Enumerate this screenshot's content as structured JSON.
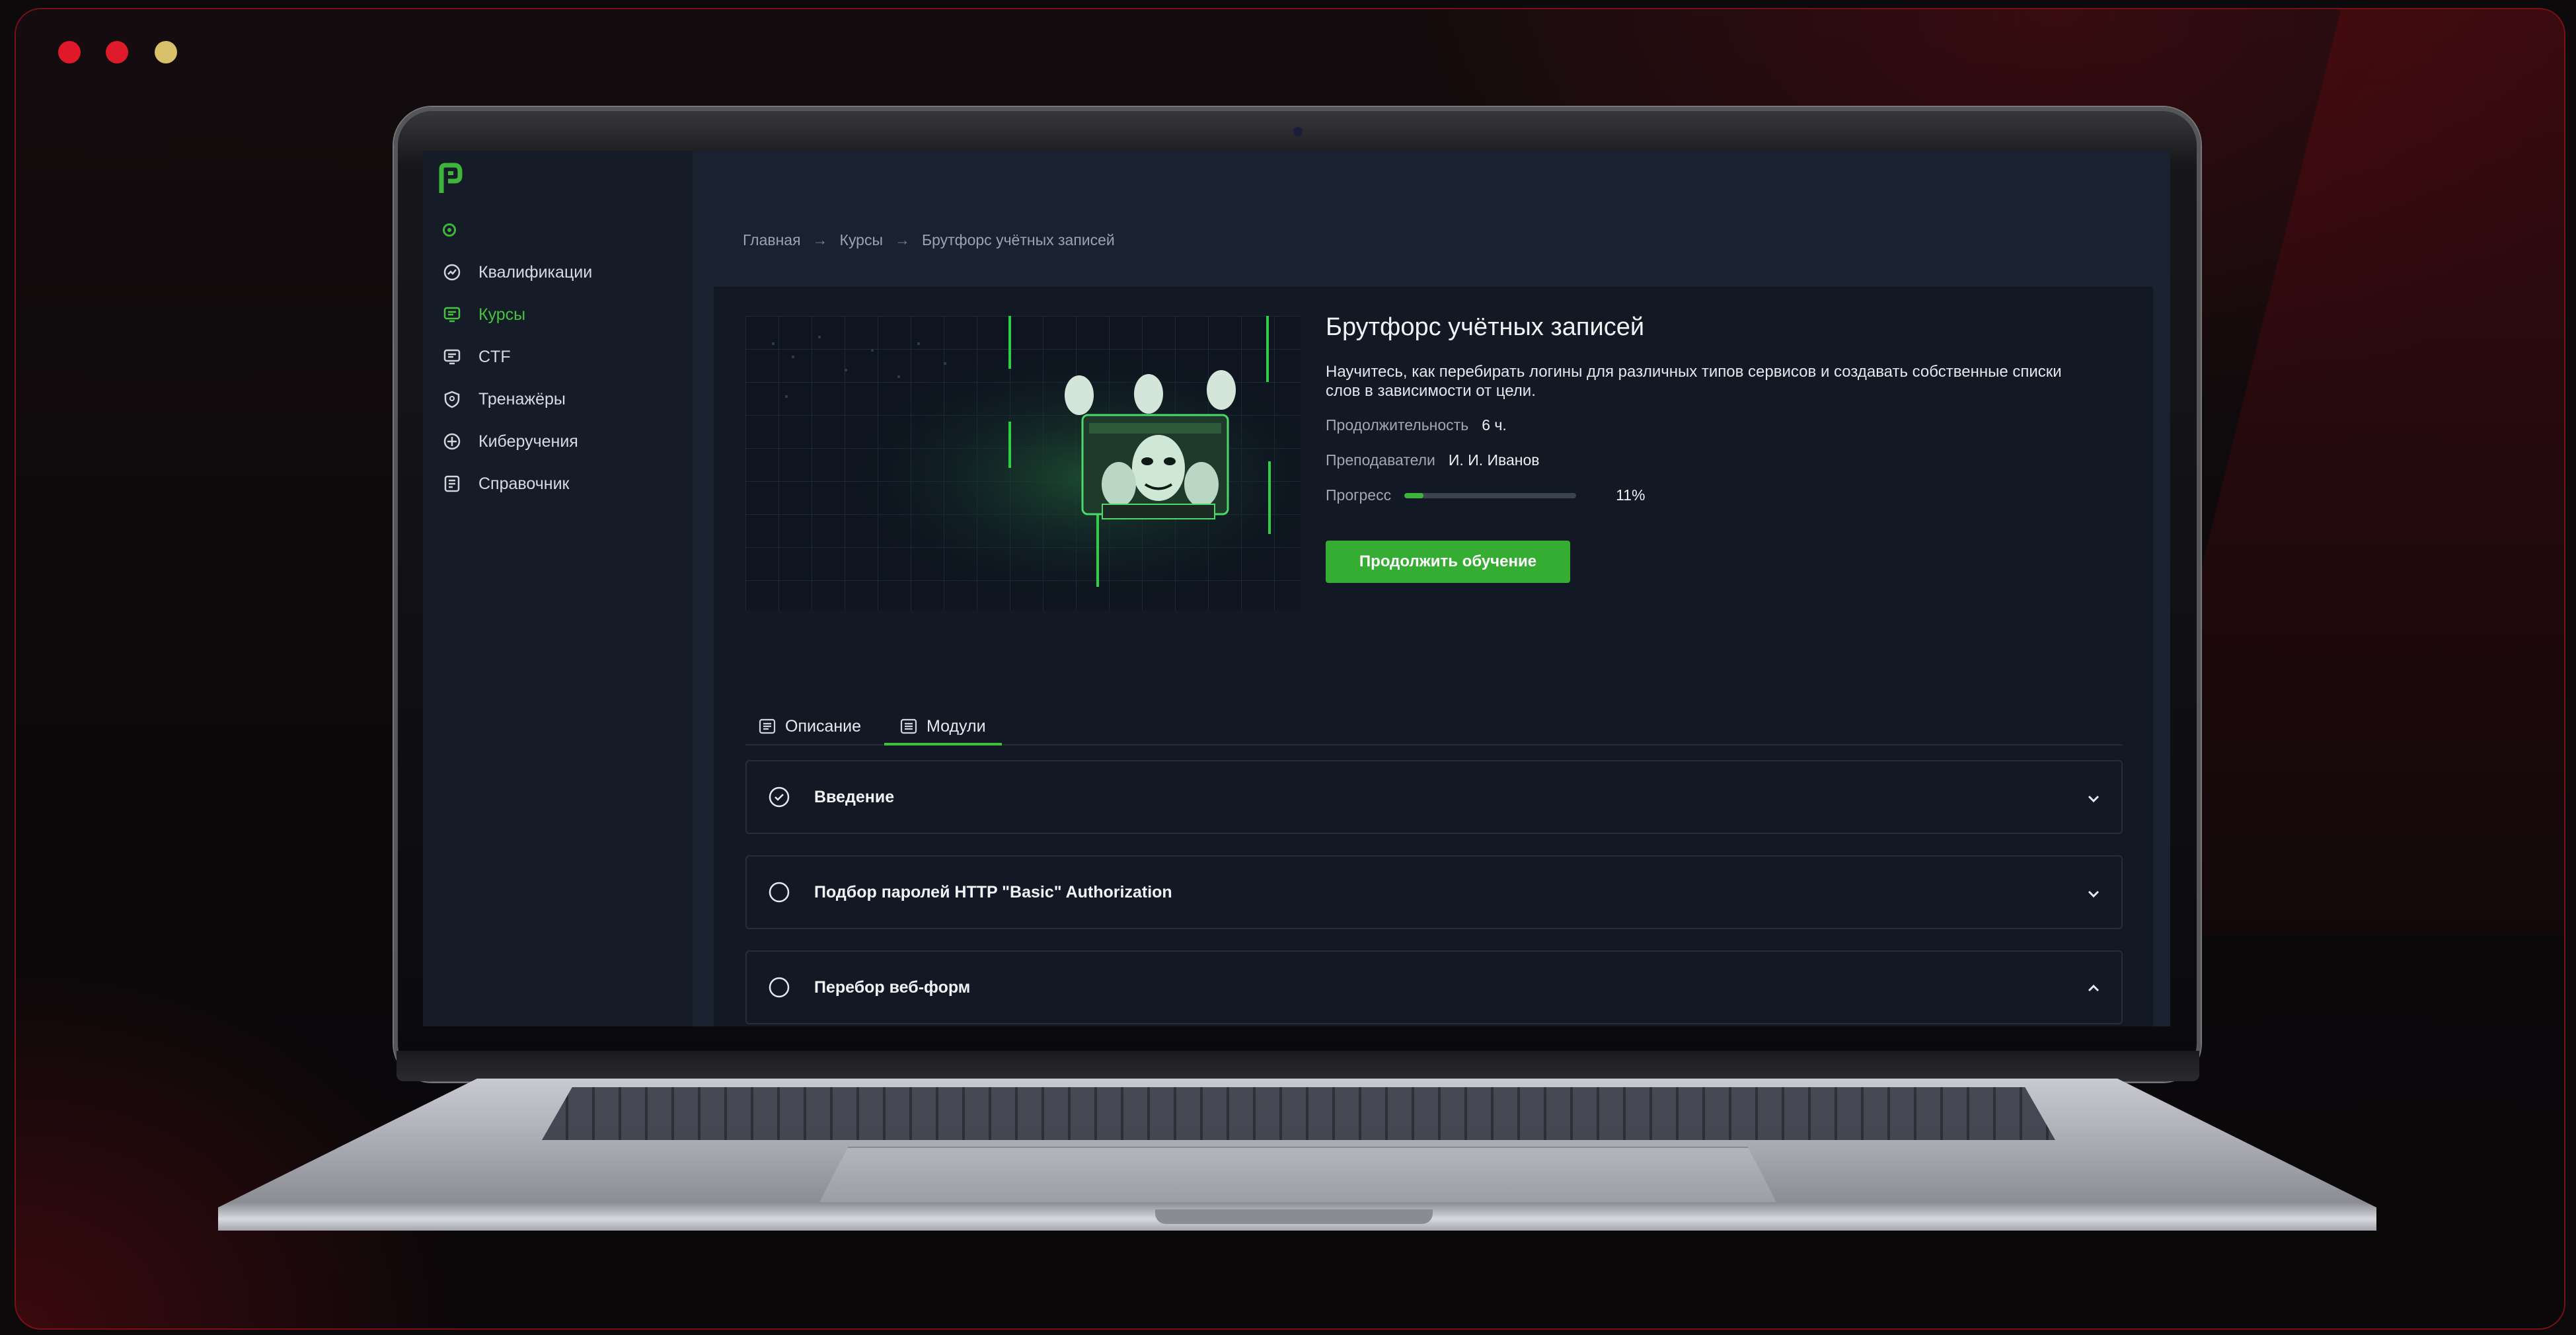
{
  "sidebar": {
    "items": [
      {
        "label": "Квалификации",
        "icon": "chart-icon",
        "active": false
      },
      {
        "label": "Курсы",
        "icon": "courses-icon",
        "active": true
      },
      {
        "label": "CTF",
        "icon": "ctf-icon",
        "active": false
      },
      {
        "label": "Тренажёры",
        "icon": "shield-icon",
        "active": false
      },
      {
        "label": "Киберучения",
        "icon": "compass-icon",
        "active": false
      },
      {
        "label": "Справочник",
        "icon": "book-icon",
        "active": false
      }
    ]
  },
  "breadcrumb": {
    "items": [
      "Главная",
      "Курсы",
      "Брутфорс учётных записей"
    ],
    "separator": "→"
  },
  "course": {
    "title": "Брутфорс учётных записей",
    "description": "Научитесь, как перебирать логины для различных типов сервисов и создавать собственные списки слов в зависимости от цели.",
    "duration_label": "Продолжительность",
    "duration_value": "6 ч.",
    "teachers_label": "Преподаватели",
    "teachers_value": "И. И. Иванов",
    "progress_label": "Прогресс",
    "progress_percent": 11,
    "progress_text": "11%",
    "continue_button": "Продолжить обучение"
  },
  "tabs": [
    {
      "label": "Описание",
      "active": false
    },
    {
      "label": "Модули",
      "active": true
    }
  ],
  "modules": [
    {
      "title": "Введение",
      "completed": true,
      "expanded": false
    },
    {
      "title": "Подбор паролей HTTP \"Basic\" Authorization",
      "completed": false,
      "expanded": false
    },
    {
      "title": "Перебор веб-форм",
      "completed": false,
      "expanded": true
    }
  ],
  "colors": {
    "accent": "#3fb43c",
    "window_close": "#e0192a",
    "window_min": "#dd1b2b",
    "window_max": "#d9c06a",
    "frame_border": "#7a1016"
  }
}
